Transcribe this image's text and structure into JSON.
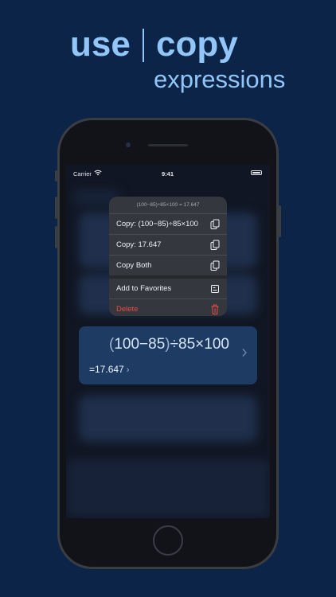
{
  "headline": {
    "use": "use",
    "copy": "copy",
    "expressions": "expressions"
  },
  "status_bar": {
    "carrier": "Carrier",
    "time": "9:41"
  },
  "menu": {
    "header": "(100−85)÷85×100 = 17.647",
    "items": [
      {
        "label": "Copy: (100−85)÷85×100",
        "icon": "copy-icon"
      },
      {
        "label": "Copy: 17.647",
        "icon": "copy-icon"
      },
      {
        "label": "Copy Both",
        "icon": "copy-icon"
      },
      {
        "label": "Add to Favorites",
        "icon": "favorites-icon"
      },
      {
        "label": "Delete",
        "icon": "trash-icon"
      }
    ]
  },
  "card": {
    "open_paren": "(",
    "expr_inner": "100−85",
    "close_paren": ")",
    "expr_rest": "÷85×100",
    "result": "=17.647",
    "result_chevron": "›"
  },
  "colors": {
    "background": "#0b2447",
    "headline": "#93c6f8",
    "delete": "#ef4a44",
    "card": "#1e3b63"
  }
}
